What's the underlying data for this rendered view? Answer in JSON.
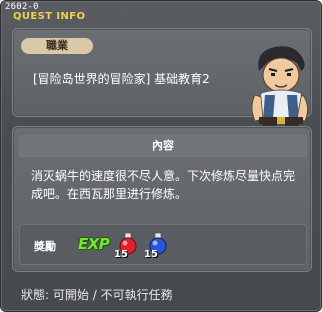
{
  "window": {
    "id": "2602-0",
    "title": "QUEST INFO"
  },
  "quest": {
    "job_tag": "職業",
    "name": "[冒险岛世界的冒险家] 基础教育2"
  },
  "content": {
    "header": "內容",
    "description": "消灭蜗牛的速度很不尽人意。下次修炼尽量快点完成吧。在西瓦那里进行修炼。"
  },
  "reward": {
    "label": "獎勵",
    "exp_label": "EXP",
    "items": [
      {
        "icon": "red-potion-icon",
        "quantity": "15"
      },
      {
        "icon": "blue-potion-icon",
        "quantity": "15"
      }
    ]
  },
  "status": {
    "label": "狀態",
    "startable": "可開始",
    "not_executable": "不可執行任務"
  },
  "colors": {
    "title": "#f0d34a",
    "exp": "#7ce03c",
    "job_tag_bg": "#d9c9a6"
  }
}
